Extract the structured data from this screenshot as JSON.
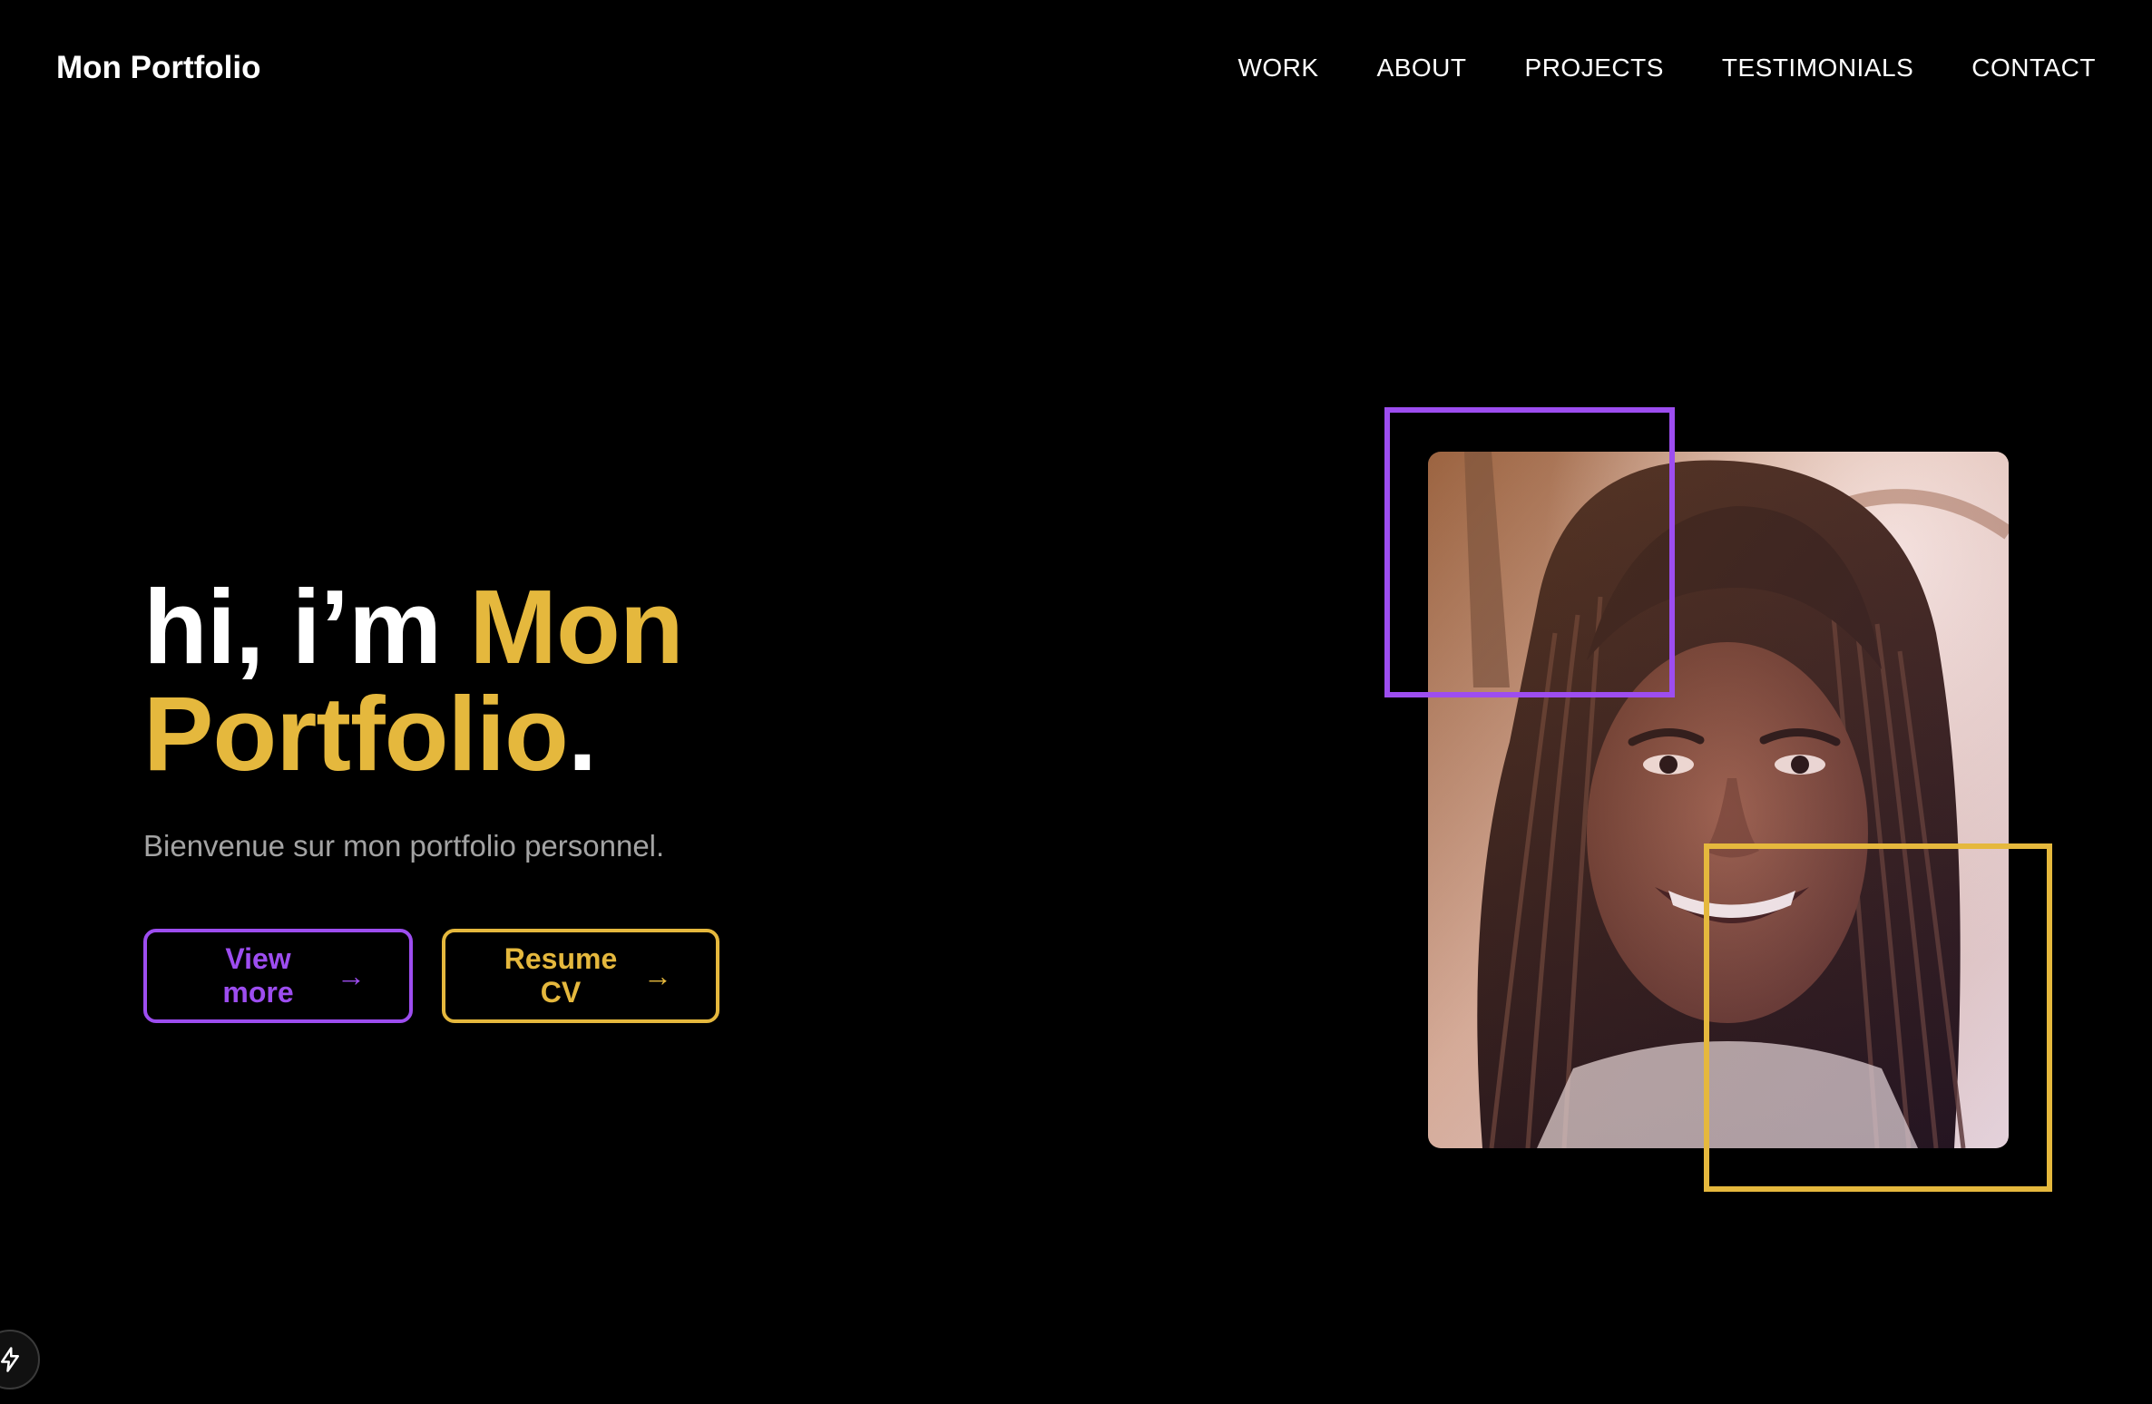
{
  "brand": "Mon Portfolio",
  "nav": {
    "items": [
      "WORK",
      "ABOUT",
      "PROJECTS",
      "TESTIMONIALS",
      "CONTACT"
    ]
  },
  "hero": {
    "greeting": "hi, i’m ",
    "name_line1": "Mon",
    "name_line2": "Portfolio",
    "period": ".",
    "subtitle": "Bienvenue sur mon portfolio personnel.",
    "view_more_label": "View more",
    "resume_label": "Resume CV",
    "arrow": "→"
  },
  "portrait": {
    "subject": "smiling woman with braided hair"
  },
  "colors": {
    "background": "#000000",
    "accent_yellow": "#e5b83d",
    "accent_purple": "#9d4df0",
    "subtitle_gray": "#a3a3a3"
  },
  "icons": {
    "corner_badge": "lightning-bolt-icon"
  }
}
